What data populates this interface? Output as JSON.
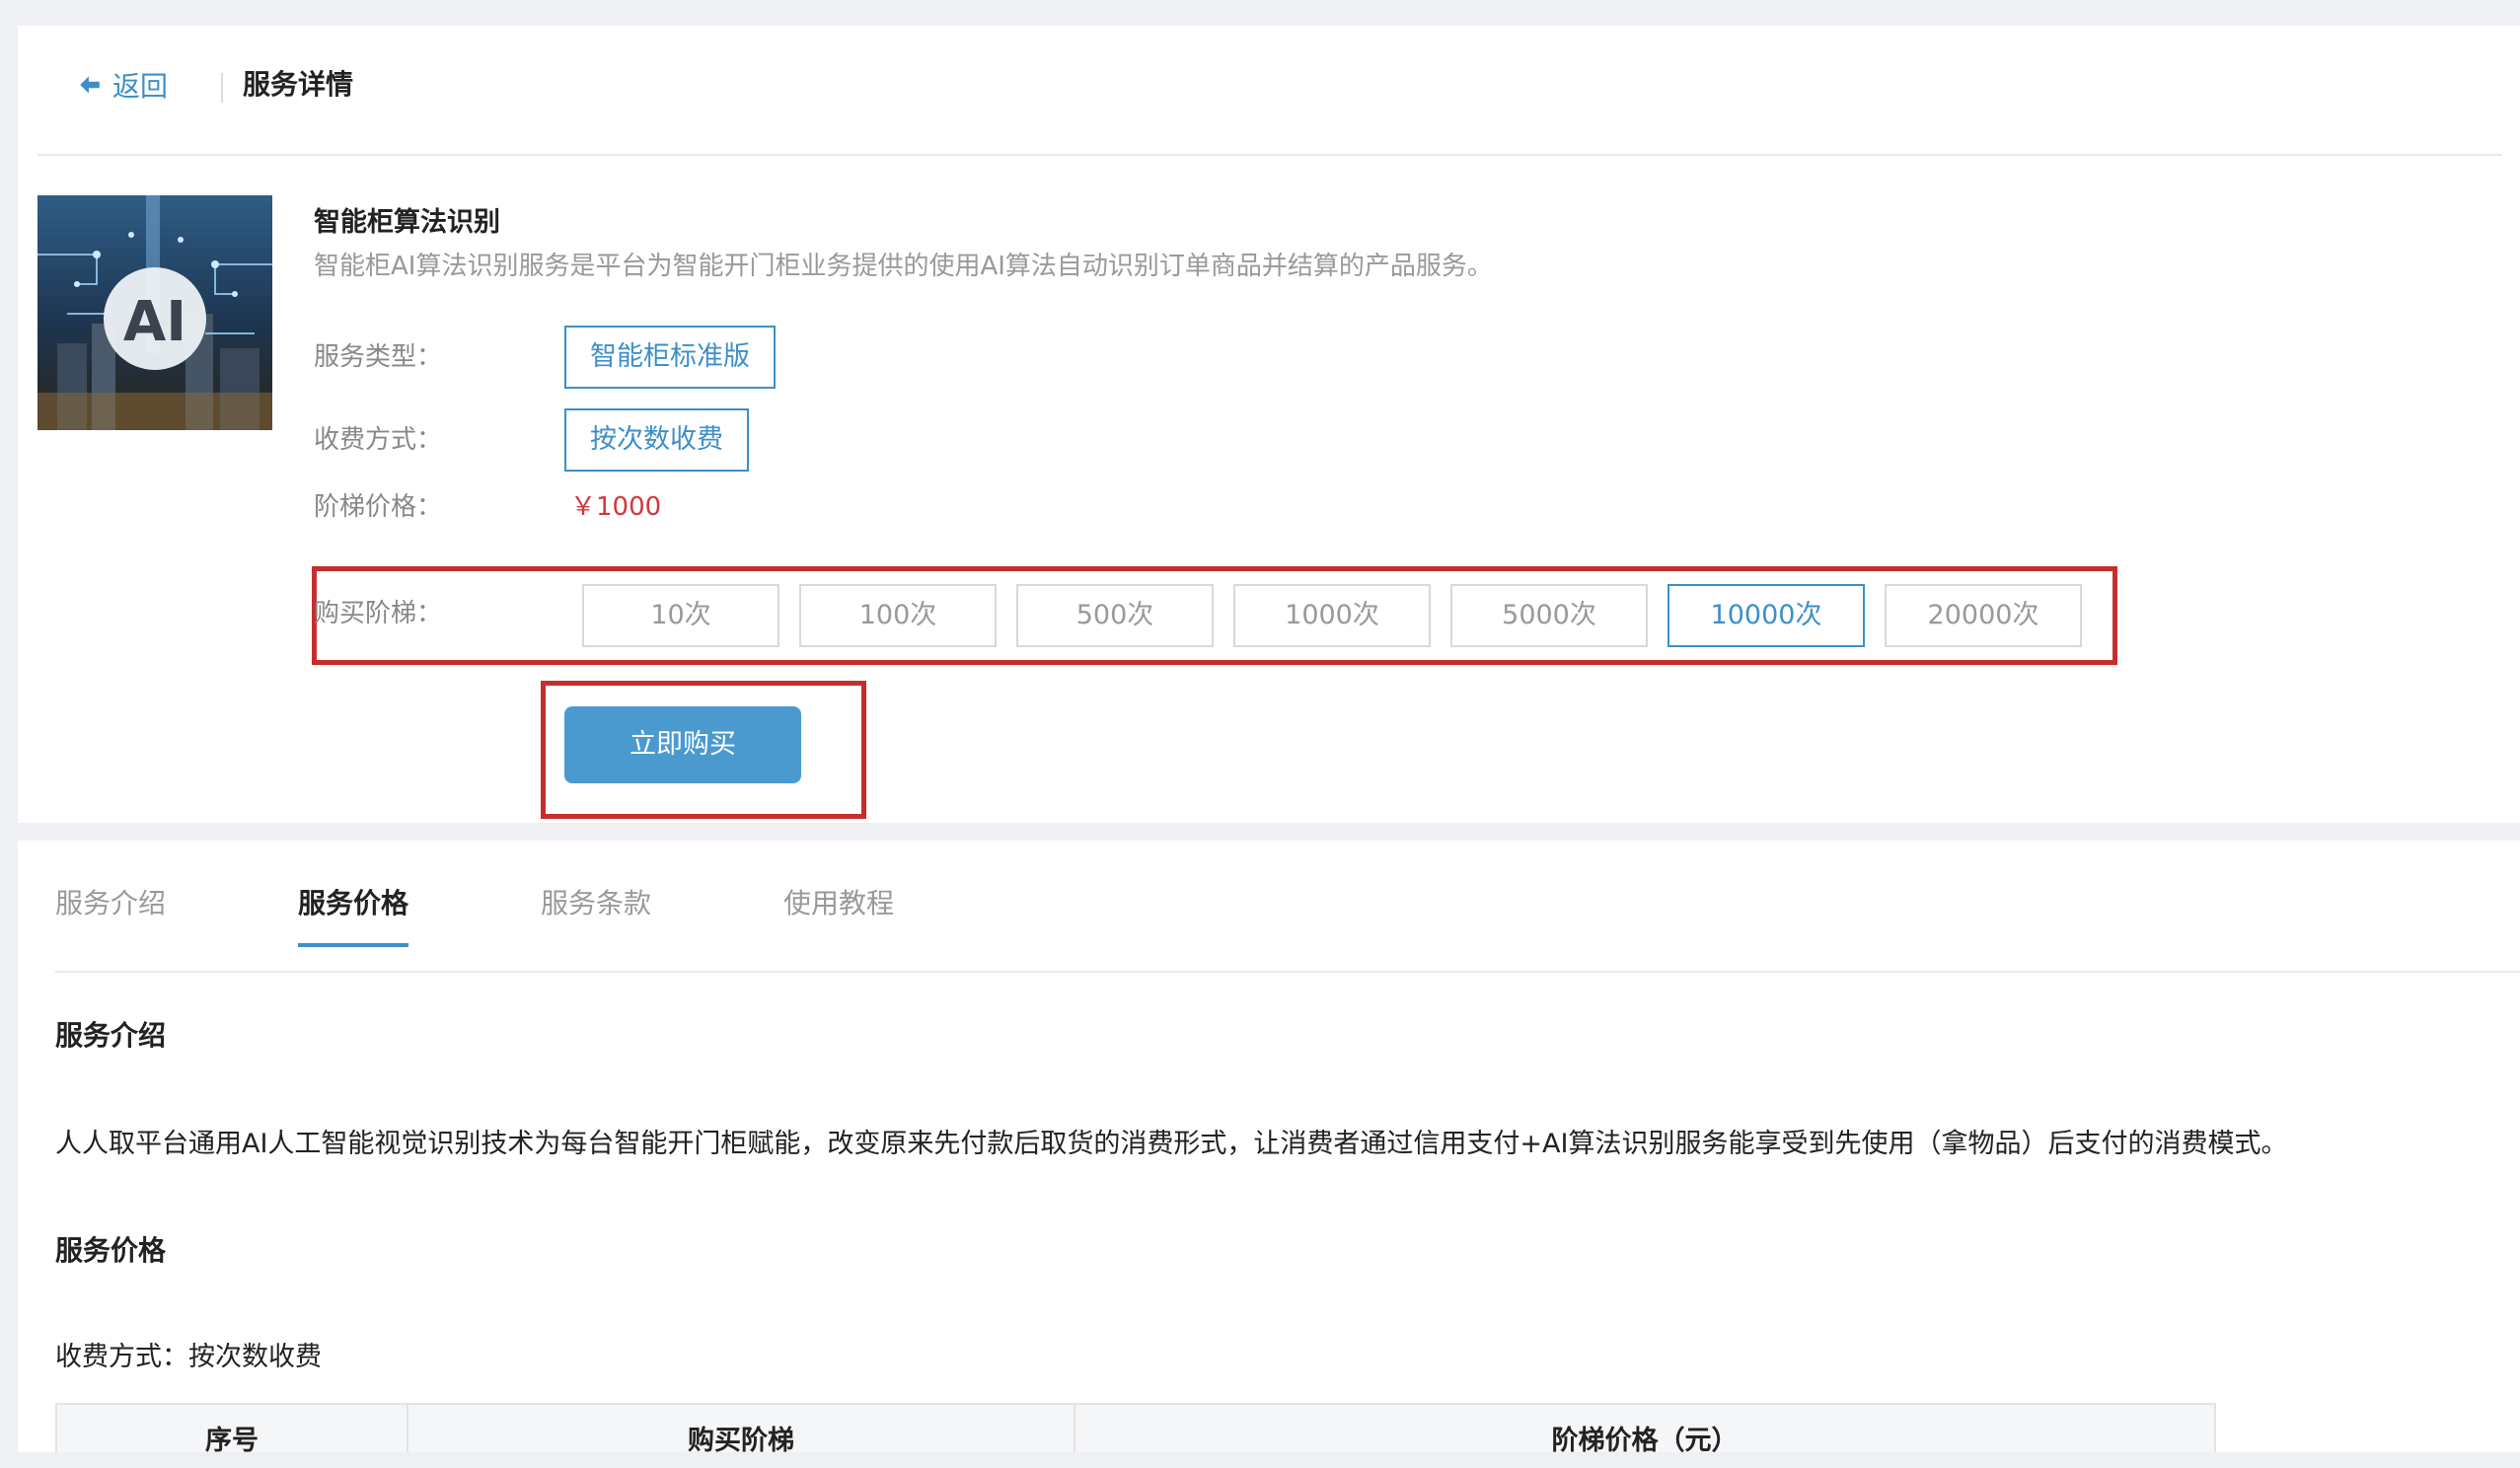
{
  "header": {
    "back_label": "返回",
    "title": "服务详情"
  },
  "product": {
    "name": "智能柜算法识别",
    "description": "智能柜AI算法识别服务是平台为智能开门柜业务提供的使用AI算法自动识别订单商品并结算的产品服务。",
    "image_text": "AI",
    "fields": {
      "service_type_label": "服务类型：",
      "service_type_value": "智能柜标准版",
      "billing_label": "收费方式：",
      "billing_value": "按次数收费",
      "price_label": "阶梯价格：",
      "price_value": "￥1000",
      "tier_label": "购买阶梯："
    },
    "tiers": [
      "10次",
      "100次",
      "500次",
      "1000次",
      "5000次",
      "10000次",
      "20000次"
    ],
    "selected_tier": "10000次",
    "buy_label": "立即购买"
  },
  "tabs": [
    {
      "label": "服务介绍",
      "active": false
    },
    {
      "label": "服务价格",
      "active": true
    },
    {
      "label": "服务条款",
      "active": false
    },
    {
      "label": "使用教程",
      "active": false
    }
  ],
  "content": {
    "intro_heading": "服务介绍",
    "intro_text": "人人取平台通用AI人工智能视觉识别技术为每台智能开门柜赋能，改变原来先付款后取货的消费形式，让消费者通过信用支付+AI算法识别服务能享受到先使用（拿物品）后支付的消费模式。",
    "price_heading": "服务价格",
    "billing_line": "收费方式：按次数收费",
    "table_headers": [
      "序号",
      "购买阶梯",
      "阶梯价格（元）"
    ]
  },
  "colors": {
    "accent": "#3d8fc9",
    "button": "#4a9ad0",
    "price": "#d4373b",
    "highlight_outline": "#c62e2e"
  }
}
